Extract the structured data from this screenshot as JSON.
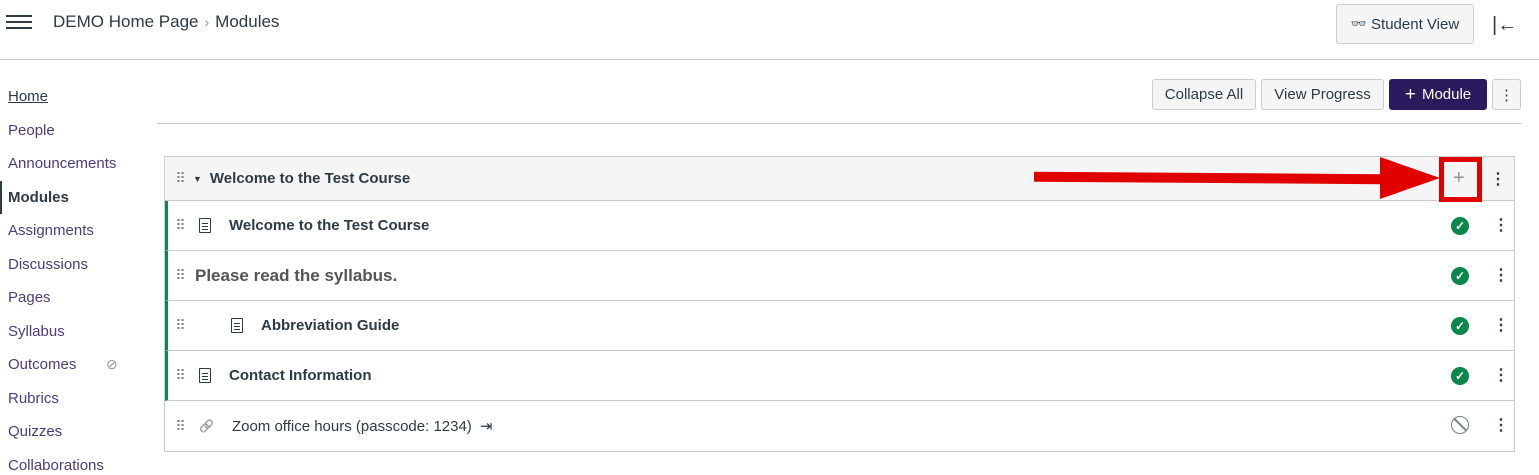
{
  "header": {
    "breadcrumb_course": "DEMO Home Page",
    "breadcrumb_separator": "›",
    "breadcrumb_current": "Modules",
    "student_view_icon": "👓",
    "student_view_label": "Student View",
    "collapse_icon": "|←"
  },
  "sidebar": {
    "items": [
      {
        "label": "Home"
      },
      {
        "label": "People"
      },
      {
        "label": "Announcements"
      },
      {
        "label": "Modules"
      },
      {
        "label": "Assignments"
      },
      {
        "label": "Discussions"
      },
      {
        "label": "Pages"
      },
      {
        "label": "Syllabus"
      },
      {
        "label": "Outcomes"
      },
      {
        "label": "Rubrics"
      },
      {
        "label": "Quizzes"
      },
      {
        "label": "Collaborations"
      }
    ],
    "eye_icon": "⊘"
  },
  "toolbar": {
    "collapse_all": "Collapse All",
    "view_progress": "View Progress",
    "module_plus": "+",
    "module_label": "Module",
    "kebab": "⋮"
  },
  "module": {
    "title": "Welcome to the Test Course",
    "drag_handle": "⠿",
    "caret": "▼",
    "add": "+",
    "kebab": "⋮",
    "items": [
      {
        "title": "Welcome to the Test Course",
        "type": "page",
        "status": "published"
      },
      {
        "title": "Please read the syllabus.",
        "type": "header",
        "status": "published"
      },
      {
        "title": "Abbreviation Guide",
        "type": "page",
        "status": "published",
        "indent": true
      },
      {
        "title": "Contact Information",
        "type": "page",
        "status": "published"
      },
      {
        "title": "Zoom office hours (passcode: 1234)",
        "type": "external-link",
        "status": "unpublished"
      }
    ],
    "check": "✓",
    "link_glyph": "🔗",
    "external_glyph": "⇥"
  },
  "colors": {
    "brand": "#2a1a5e",
    "published": "#0b874b",
    "annotation": "#e00000"
  }
}
